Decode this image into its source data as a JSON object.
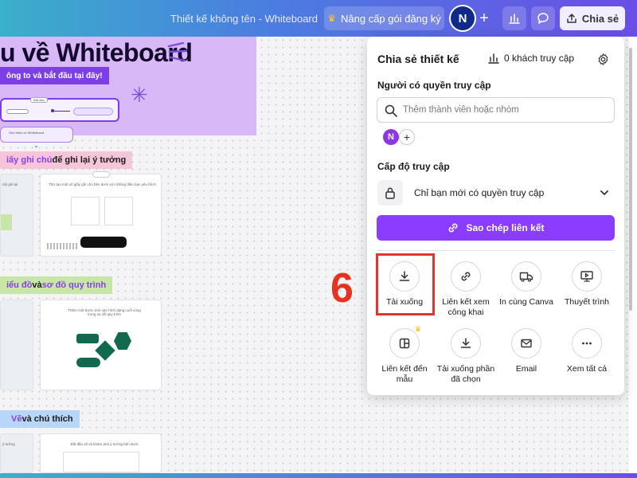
{
  "topbar": {
    "doc_title": "Thiết kế không tên - Whiteboard",
    "upgrade_label": "Nâng cấp gói đăng ký",
    "user_initial": "N",
    "share_label": "Chia sẻ",
    "icons": {
      "upgrade": "crown-icon",
      "add": "plus-icon",
      "insights": "bar-chart-icon",
      "comments": "comment-icon",
      "share": "upload-icon"
    }
  },
  "whiteboard": {
    "hero_title": "u về Whiteboard",
    "hero_subtitle": "ông to và bắt đầu tại đây!",
    "hero_card_text": "Bắt đầu",
    "hero_card2_text": "Giới thiệu về Whiteboard",
    "section1": {
      "prefix": "iấy ghi chú",
      "suffix": " để ghi lại ý tưởng"
    },
    "section1_frame_text": "Thử tạo một số giấy ghi chú bên dưới với những điều bạn yêu thích",
    "section1_left_text": "nội ghi lại",
    "section2": {
      "part1": "iểu đồ",
      "part2": " và ",
      "part3": "sơ đồ quy trình"
    },
    "section2_frame_text": "Thêm một bước mới vào hình dạng cuối cùng trong sơ đồ quy trình",
    "section3": {
      "prefix": "Vẽ",
      "suffix": " và chú thích"
    },
    "section3_frame_text": "Bắt đầu vẽ và khám phá ý tưởng bên dưới",
    "section3_left_text": "ý tưởng"
  },
  "share_panel": {
    "title": "Chia sẻ thiết kế",
    "visitors": "0 khách truy cập",
    "people_label": "Người có quyền truy cập",
    "search_placeholder": "Thêm thành viên hoặc nhóm",
    "member_initial": "N",
    "access_level_label": "Cấp độ truy cập",
    "access_value": "Chỉ bạn mới có quyền truy cập",
    "copy_link_label": "Sao chép liên kết",
    "options": [
      {
        "label": "Tải xuống",
        "icon": "download-icon",
        "highlighted": true
      },
      {
        "label": "Liên kết xem công khai",
        "icon": "link-icon"
      },
      {
        "label": "In cùng Canva",
        "icon": "truck-icon"
      },
      {
        "label": "Thuyết trình",
        "icon": "presentation-icon"
      },
      {
        "label": "Liên kết đến mẫu",
        "icon": "template-icon",
        "premium": true
      },
      {
        "label": "Tải xuống phần đã chọn",
        "icon": "download-icon"
      },
      {
        "label": "Email",
        "icon": "mail-icon"
      },
      {
        "label": "Xem tất cả",
        "icon": "more-icon"
      }
    ]
  },
  "annotation": {
    "step_number": "6"
  },
  "colors": {
    "primary": "#8b3dff",
    "highlight": "#e3342f",
    "step": "#e8311f",
    "hero_bg": "#d8b8f7"
  }
}
